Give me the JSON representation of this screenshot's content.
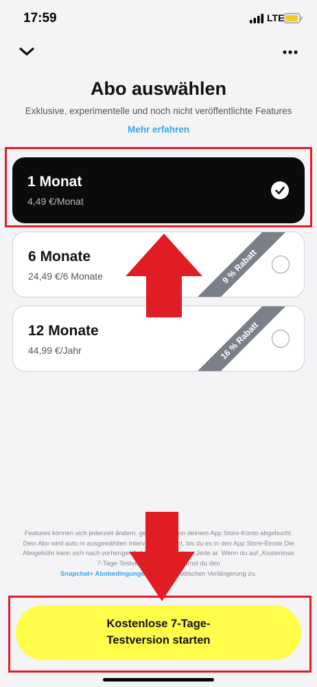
{
  "status_bar": {
    "time": "17:59",
    "network": "LTE"
  },
  "header": {
    "title": "Abo auswählen",
    "subtitle": "Exklusive, experimentelle und noch nicht veröffentlichte Features",
    "learn_more": "Mehr erfahren"
  },
  "plans": [
    {
      "name": "1 Monat",
      "price": "4,49 €/Monat",
      "selected": true,
      "badge": ""
    },
    {
      "name": "6 Monate",
      "price": "24,49 €/6 Monate",
      "selected": false,
      "badge": "9 % Rabatt"
    },
    {
      "name": "12 Monate",
      "price": "44,99 €/Jahr",
      "selected": false,
      "badge": "16 % Rabatt"
    }
  ],
  "fine_print": {
    "text_1": "Features können sich jederzeit ändern.",
    "text_2": "gen werden von deinem App Store-Konto abgebucht. Dein Abo wird auto",
    "text_3": "m ausgewählten Intervall verlängert, bis du es in den App Store-Einste",
    "text_4": "Die Abogebühr kann sich nach vorheriger Ankündigung ändern. Jede",
    "text_5": "ar. Wenn du auf „Kostenlose 7-Tage-Testversion starten",
    "text_6": "stimmst du den",
    "terms_link": "Snapchat+ Abobedingungen",
    "text_7": "und",
    "text_8": "automatischen Verlängerung zu."
  },
  "cta": {
    "line_1": "Kostenlose 7-Tage-",
    "line_2": "Testversion starten"
  },
  "colors": {
    "accent": "#3aa6e6",
    "cta": "#fffc4a",
    "highlight": "#e01c24",
    "badge": "#7a7f89"
  }
}
